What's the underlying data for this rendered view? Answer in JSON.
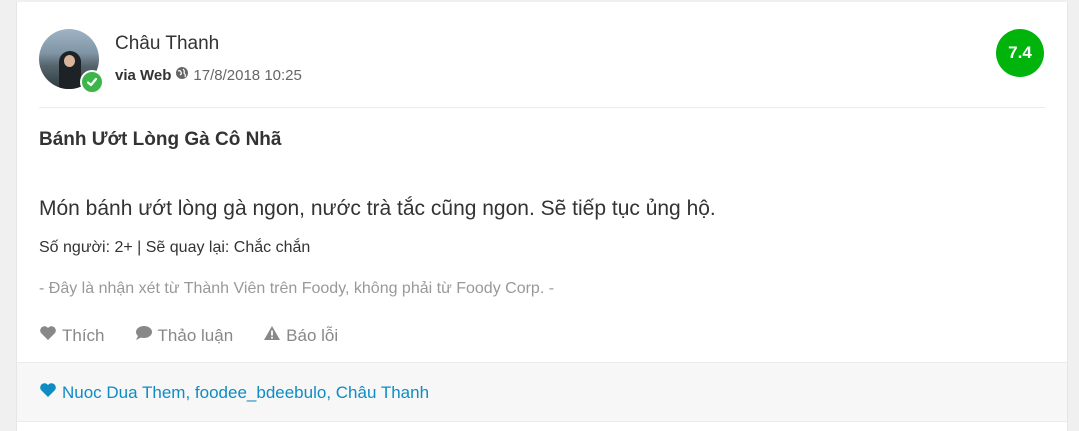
{
  "review": {
    "user_name": "Châu Thanh",
    "via_label": "via Web",
    "timestamp": "17/8/2018 10:25",
    "score": "7.4",
    "title": "Bánh Ướt Lòng Gà Cô Nhã",
    "body": "Món bánh ướt lòng gà ngon, nước trà tắc cũng ngon. Sẽ tiếp tục ủng hộ.",
    "extra_info": "Số người: 2+ | Sẽ quay lại: Chắc chắn",
    "disclaimer": "- Đây là nhận xét từ Thành Viên trên Foody, không phải từ Foody Corp. -"
  },
  "actions": {
    "like_label": "Thích",
    "discuss_label": "Thảo luận",
    "report_label": "Báo lỗi"
  },
  "footer": {
    "likers": "Nuoc Dua Them, foodee_bdeebulo, Châu Thanh"
  },
  "colors": {
    "score_bg": "#00b40c",
    "verified": "#3cb64a",
    "link": "#0e8cc4"
  },
  "icons": [
    "verified-check-icon",
    "globe-icon",
    "heart-icon",
    "comment-icon",
    "warning-icon"
  ]
}
